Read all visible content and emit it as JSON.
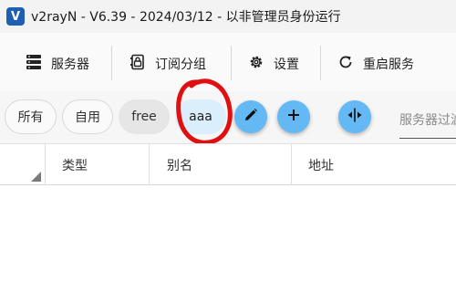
{
  "window": {
    "title": "v2rayN - V6.39 - 2024/03/12 - 以非管理员身份运行",
    "logo_letter": "V"
  },
  "toolbar": {
    "servers_label": "服务器",
    "subscription_group_label": "订阅分组",
    "settings_label": "设置",
    "restart_service_label": "重启服务"
  },
  "groups": {
    "items": [
      {
        "label": "所有"
      },
      {
        "label": "自用"
      },
      {
        "label": "free"
      },
      {
        "label": "aaa"
      }
    ],
    "selected": "aaa"
  },
  "search": {
    "placeholder": "服务器过滤"
  },
  "table": {
    "columns": [
      "类型",
      "别名",
      "地址"
    ]
  },
  "colors": {
    "accent": "#64b8f4",
    "selected_chip": "#dbeefc",
    "annotation": "#e01010"
  }
}
